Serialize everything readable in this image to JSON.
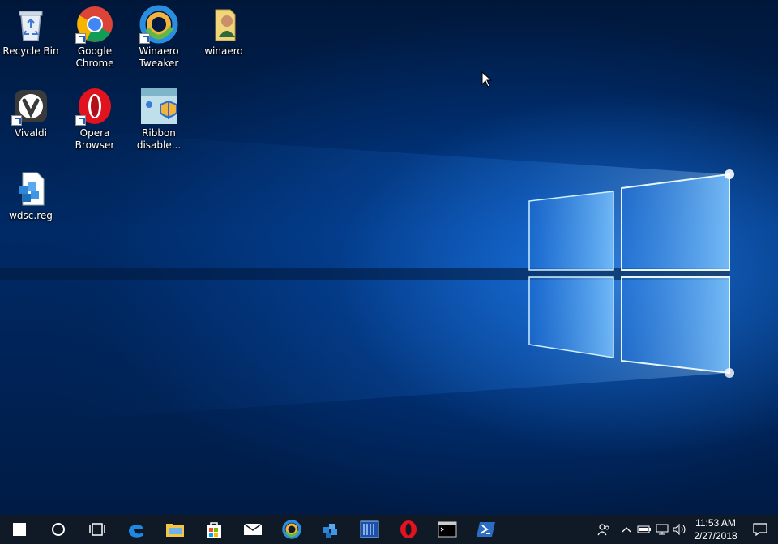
{
  "desktop": {
    "icons": [
      {
        "label": "Recycle Bin",
        "icon": "recycle-bin-icon"
      },
      {
        "label": "Google Chrome",
        "icon": "chrome-icon",
        "shortcut": true
      },
      {
        "label": "Winaero Tweaker",
        "icon": "winaero-tweaker-icon",
        "shortcut": true
      },
      {
        "label": "winaero",
        "icon": "user-folder-icon"
      },
      {
        "label": "Vivaldi",
        "icon": "vivaldi-icon",
        "shortcut": true
      },
      {
        "label": "Opera Browser",
        "icon": "opera-icon",
        "shortcut": true
      },
      {
        "label": "Ribbon disable...",
        "icon": "ribbon-disabler-icon"
      },
      {
        "label": "wdsc.reg",
        "icon": "registry-file-icon"
      }
    ]
  },
  "taskbar": {
    "start": "windows-start-icon",
    "search": "cortana-search-icon",
    "task_view": "task-view-icon",
    "pinned": [
      "edge-icon",
      "file-explorer-icon",
      "store-icon",
      "mail-icon",
      "winaero-tweaker-icon",
      "registry-editor-icon",
      "event-viewer-icon",
      "opera-icon",
      "command-prompt-icon",
      "powershell-icon"
    ],
    "tray": {
      "people": "people-icon",
      "show_hidden": "chevron-up-icon",
      "battery": "battery-icon",
      "network": "network-icon",
      "volume": "volume-icon",
      "time": "11:53 AM",
      "date": "2/27/2018",
      "action_center": "action-center-icon"
    }
  },
  "colors": {
    "taskbar": "#101a26",
    "desktop_dark": "#00173a",
    "glow": "#3aa0ff"
  }
}
